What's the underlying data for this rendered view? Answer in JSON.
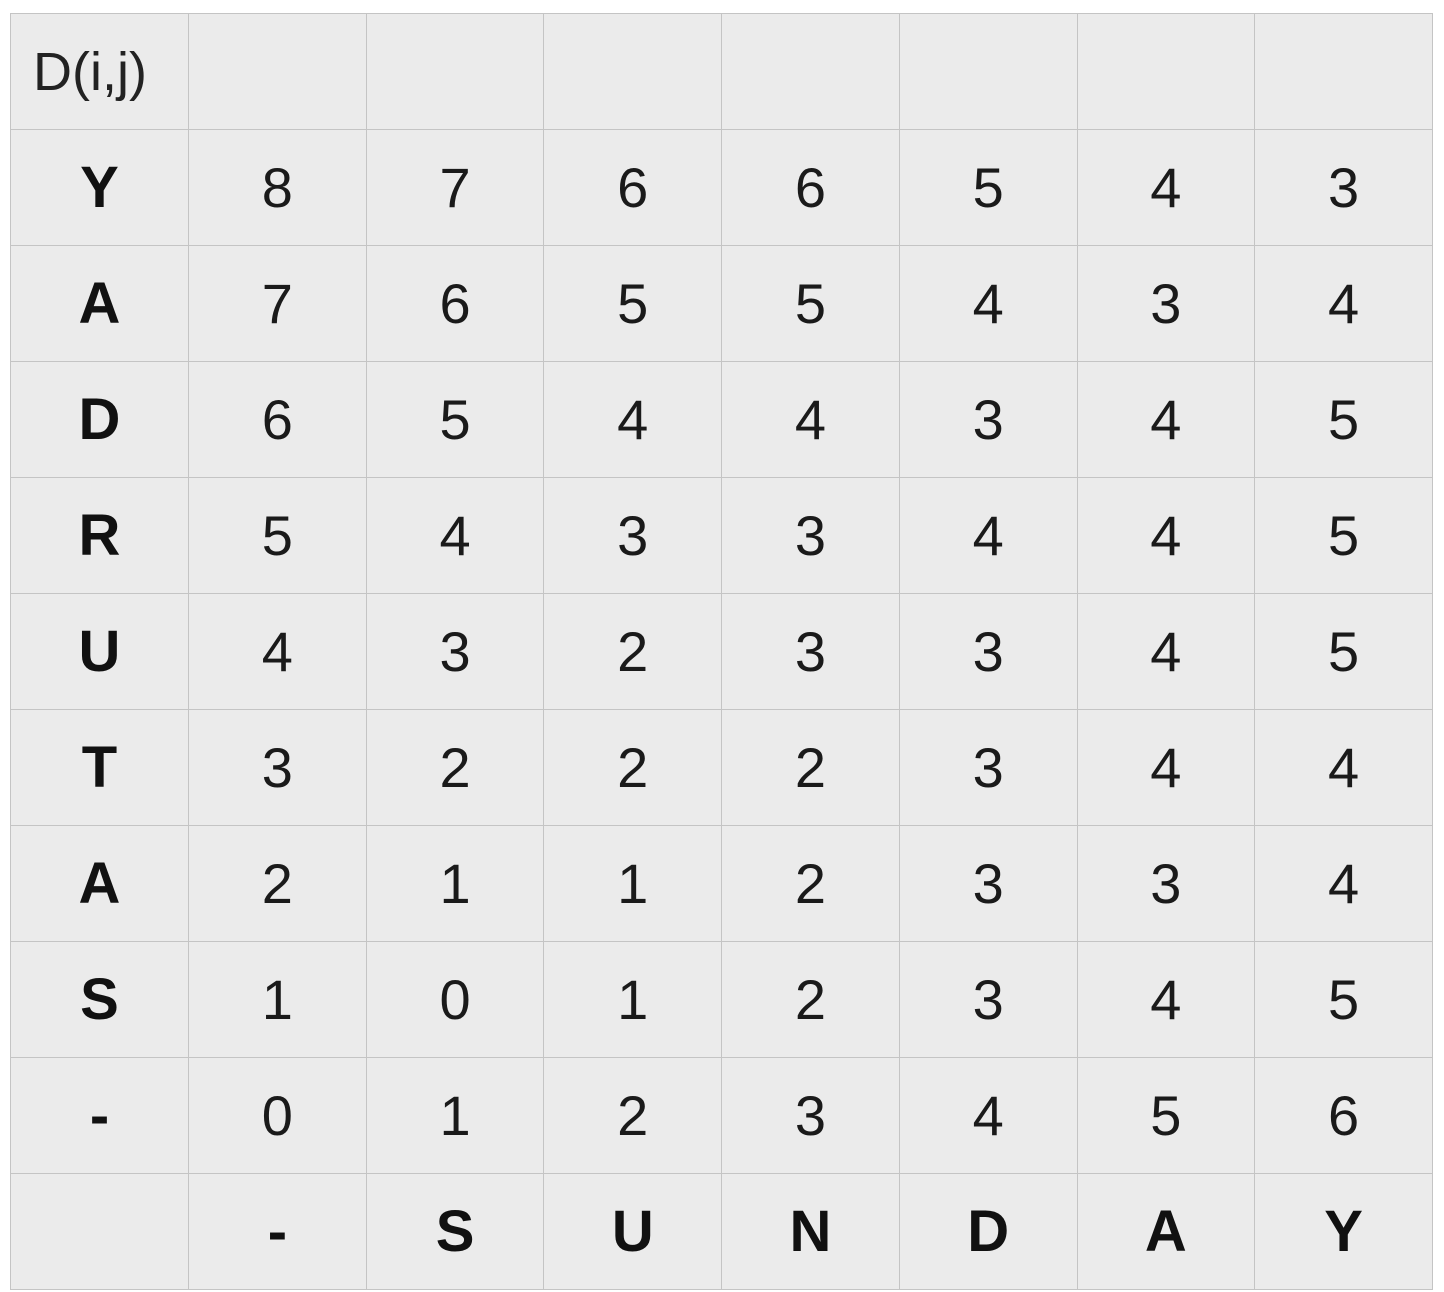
{
  "chart_data": {
    "type": "table",
    "title": "D(i,j)",
    "row_labels": [
      "Y",
      "A",
      "D",
      "R",
      "U",
      "T",
      "A",
      "S",
      "-"
    ],
    "col_labels": [
      "-",
      "S",
      "U",
      "N",
      "D",
      "A",
      "Y"
    ],
    "cells": [
      [
        8,
        7,
        6,
        6,
        5,
        4,
        3
      ],
      [
        7,
        6,
        5,
        5,
        4,
        3,
        4
      ],
      [
        6,
        5,
        4,
        4,
        3,
        4,
        5
      ],
      [
        5,
        4,
        3,
        3,
        4,
        4,
        5
      ],
      [
        4,
        3,
        2,
        3,
        3,
        4,
        5
      ],
      [
        3,
        2,
        2,
        2,
        3,
        4,
        4
      ],
      [
        2,
        1,
        1,
        2,
        3,
        3,
        4
      ],
      [
        1,
        0,
        1,
        2,
        3,
        4,
        5
      ],
      [
        0,
        1,
        2,
        3,
        4,
        5,
        6
      ]
    ]
  },
  "colors": {
    "cell_background": "#ebebeb",
    "grid_line": "#c4c4c4",
    "text": "#1a1a1a"
  }
}
